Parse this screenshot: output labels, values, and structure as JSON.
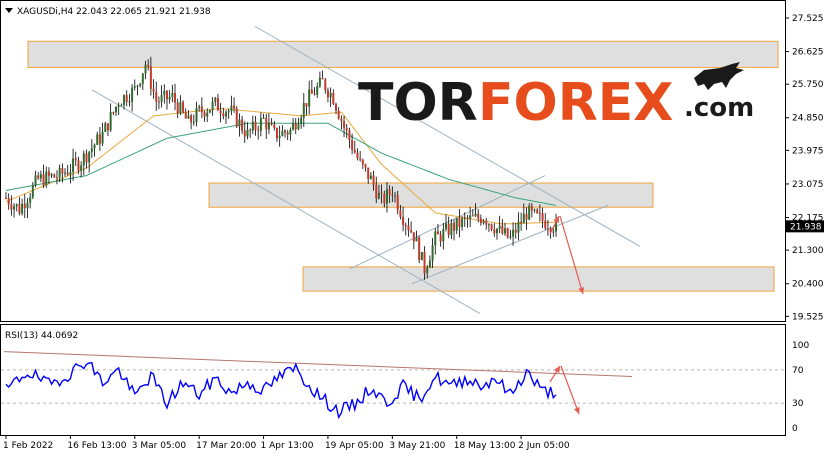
{
  "chart_data": [
    {
      "type": "candlestick",
      "symbol_header": "XAGUSDi,H4  22.043  22.065  21.921  21.938",
      "current_price": 21.938,
      "current_price_label": "21.938",
      "ylim": [
        19.4,
        27.9
      ],
      "y_ticks": [
        {
          "value": 27.525,
          "label": "27.525"
        },
        {
          "value": 26.625,
          "label": "26.625"
        },
        {
          "value": 25.75,
          "label": "25.750"
        },
        {
          "value": 24.85,
          "label": "24.850"
        },
        {
          "value": 23.975,
          "label": "23.975"
        },
        {
          "value": 23.075,
          "label": "23.075"
        },
        {
          "value": 22.175,
          "label": "22.175"
        },
        {
          "value": 21.3,
          "label": "21.300"
        },
        {
          "value": 20.4,
          "label": "20.400"
        },
        {
          "value": 19.525,
          "label": "19.525"
        }
      ],
      "x_ticks": [
        "1 Feb 2022",
        "16 Feb 13:00",
        "3 Mar 05:00",
        "17 Mar 20:00",
        "1 Apr 13:00",
        "19 Apr 05:00",
        "3 May 21:00",
        "18 May 13:00",
        "2 Jun 05:00"
      ],
      "x_tick_bar_index": [
        0,
        24,
        48,
        72,
        96,
        120,
        144,
        168,
        192
      ],
      "bar_count": 206,
      "price_anchors": [
        {
          "bar": 0,
          "price": 22.7
        },
        {
          "bar": 5,
          "price": 22.4
        },
        {
          "bar": 12,
          "price": 23.2
        },
        {
          "bar": 20,
          "price": 23.3
        },
        {
          "bar": 28,
          "price": 23.7
        },
        {
          "bar": 36,
          "price": 24.4
        },
        {
          "bar": 42,
          "price": 25.3
        },
        {
          "bar": 48,
          "price": 25.6
        },
        {
          "bar": 52,
          "price": 26.3
        },
        {
          "bar": 56,
          "price": 25.3
        },
        {
          "bar": 62,
          "price": 25.4
        },
        {
          "bar": 68,
          "price": 24.7
        },
        {
          "bar": 72,
          "price": 25.0
        },
        {
          "bar": 78,
          "price": 25.2
        },
        {
          "bar": 84,
          "price": 25.0
        },
        {
          "bar": 90,
          "price": 24.4
        },
        {
          "bar": 96,
          "price": 24.8
        },
        {
          "bar": 100,
          "price": 24.4
        },
        {
          "bar": 106,
          "price": 24.5
        },
        {
          "bar": 112,
          "price": 25.3
        },
        {
          "bar": 118,
          "price": 25.8
        },
        {
          "bar": 122,
          "price": 25.4
        },
        {
          "bar": 126,
          "price": 24.6
        },
        {
          "bar": 132,
          "price": 23.6
        },
        {
          "bar": 136,
          "price": 23.2
        },
        {
          "bar": 140,
          "price": 22.6
        },
        {
          "bar": 144,
          "price": 22.9
        },
        {
          "bar": 148,
          "price": 22.2
        },
        {
          "bar": 152,
          "price": 21.7
        },
        {
          "bar": 156,
          "price": 20.8
        },
        {
          "bar": 160,
          "price": 21.6
        },
        {
          "bar": 166,
          "price": 21.9
        },
        {
          "bar": 172,
          "price": 22.1
        },
        {
          "bar": 178,
          "price": 22.2
        },
        {
          "bar": 184,
          "price": 21.8
        },
        {
          "bar": 188,
          "price": 21.6
        },
        {
          "bar": 194,
          "price": 22.3
        },
        {
          "bar": 200,
          "price": 22.1
        },
        {
          "bar": 205,
          "price": 21.938
        }
      ],
      "moving_averages": [
        {
          "color": "#e8a93c",
          "points": [
            {
              "bar": 0,
              "price": 22.6
            },
            {
              "bar": 30,
              "price": 23.5
            },
            {
              "bar": 55,
              "price": 24.9
            },
            {
              "bar": 80,
              "price": 25.1
            },
            {
              "bar": 110,
              "price": 24.9
            },
            {
              "bar": 125,
              "price": 25.0
            },
            {
              "bar": 140,
              "price": 23.6
            },
            {
              "bar": 160,
              "price": 22.3
            },
            {
              "bar": 185,
              "price": 22.0
            },
            {
              "bar": 205,
              "price": 22.05
            }
          ]
        },
        {
          "color": "#3aa37a",
          "points": [
            {
              "bar": 0,
              "price": 22.9
            },
            {
              "bar": 30,
              "price": 23.3
            },
            {
              "bar": 60,
              "price": 24.3
            },
            {
              "bar": 90,
              "price": 24.7
            },
            {
              "bar": 120,
              "price": 24.7
            },
            {
              "bar": 140,
              "price": 23.9
            },
            {
              "bar": 165,
              "price": 23.2
            },
            {
              "bar": 190,
              "price": 22.7
            },
            {
              "bar": 205,
              "price": 22.5
            }
          ]
        }
      ],
      "zones": [
        {
          "bar_start": 6,
          "bar_end": 206,
          "price_top": 26.9,
          "price_bottom": 26.2
        },
        {
          "bar_start": 52,
          "bar_end": 206,
          "price_top": 23.1,
          "price_bottom": 22.45
        },
        {
          "bar_start": 76,
          "bar_end": 206,
          "price_top": 20.85,
          "price_bottom": 20.2
        }
      ],
      "channel_lines": [
        {
          "from": {
            "bar": 22,
            "price": 25.6
          },
          "to": {
            "bar": 138,
            "price": 19.6
          }
        },
        {
          "from": {
            "bar": 62,
            "price": 27.3
          },
          "to": {
            "bar": 182,
            "price": 21.4
          }
        },
        {
          "from": {
            "bar": 112,
            "price": 20.4
          },
          "to": {
            "bar": 182,
            "price": 22.5
          }
        },
        {
          "from": {
            "bar": 92,
            "price": 20.8
          },
          "to": {
            "bar": 160,
            "price": 23.3
          }
        }
      ],
      "forecast_arrows": [
        {
          "from": {
            "bar": 189,
            "price": 21.9
          },
          "to": {
            "bar": 194,
            "price": 22.4
          }
        },
        {
          "from": {
            "bar": 195,
            "price": 22.4
          },
          "to": {
            "bar": 202,
            "price": 20.35
          }
        }
      ],
      "colors": {
        "bull": "#2f6b2f",
        "bear": "#c0392b",
        "wick": "#000000",
        "zone_fill": "#d9d9d9",
        "zone_border": "#f2a33a",
        "channel": "#9fb2c0",
        "arrow": "#e65c4f",
        "price_label_bg": "#000000"
      }
    },
    {
      "type": "line",
      "title": "RSI(13) 44.0692",
      "ylim": [
        0,
        100
      ],
      "y_ticks": [
        {
          "value": 100,
          "label": "100"
        },
        {
          "value": 70,
          "label": "70"
        },
        {
          "value": 30,
          "label": "30"
        },
        {
          "value": 0,
          "label": "0"
        }
      ],
      "levels": [
        70,
        30
      ],
      "anchors": [
        {
          "bar": 0,
          "value": 45
        },
        {
          "bar": 8,
          "value": 68
        },
        {
          "bar": 16,
          "value": 52
        },
        {
          "bar": 24,
          "value": 66
        },
        {
          "bar": 30,
          "value": 82
        },
        {
          "bar": 36,
          "value": 55
        },
        {
          "bar": 42,
          "value": 70
        },
        {
          "bar": 48,
          "value": 38
        },
        {
          "bar": 54,
          "value": 63
        },
        {
          "bar": 60,
          "value": 30
        },
        {
          "bar": 66,
          "value": 55
        },
        {
          "bar": 72,
          "value": 40
        },
        {
          "bar": 78,
          "value": 60
        },
        {
          "bar": 84,
          "value": 42
        },
        {
          "bar": 90,
          "value": 55
        },
        {
          "bar": 96,
          "value": 45
        },
        {
          "bar": 102,
          "value": 62
        },
        {
          "bar": 108,
          "value": 72
        },
        {
          "bar": 112,
          "value": 55
        },
        {
          "bar": 118,
          "value": 35
        },
        {
          "bar": 124,
          "value": 20
        },
        {
          "bar": 130,
          "value": 28
        },
        {
          "bar": 136,
          "value": 48
        },
        {
          "bar": 142,
          "value": 30
        },
        {
          "bar": 148,
          "value": 50
        },
        {
          "bar": 154,
          "value": 35
        },
        {
          "bar": 160,
          "value": 62
        },
        {
          "bar": 166,
          "value": 50
        },
        {
          "bar": 172,
          "value": 60
        },
        {
          "bar": 178,
          "value": 50
        },
        {
          "bar": 182,
          "value": 62
        },
        {
          "bar": 188,
          "value": 40
        },
        {
          "bar": 194,
          "value": 68
        },
        {
          "bar": 200,
          "value": 44
        },
        {
          "bar": 205,
          "value": 44
        }
      ],
      "trend_line": {
        "from": {
          "bar": 0,
          "value": 92
        },
        "to": {
          "bar": 228,
          "value": 62
        }
      },
      "forecast_arrows": [
        {
          "from": {
            "bar": 196,
            "value": 52
          },
          "to": {
            "bar": 201,
            "value": 63
          }
        },
        {
          "from": {
            "bar": 201,
            "value": 63
          },
          "to": {
            "bar": 208,
            "value": 18
          }
        }
      ],
      "colors": {
        "line": "#0000ff",
        "trend": "#b5776e",
        "arrow": "#e65c4f"
      }
    }
  ],
  "watermark": {
    "tor": "TOR",
    "forex": "FOREX",
    "com": ".com"
  }
}
